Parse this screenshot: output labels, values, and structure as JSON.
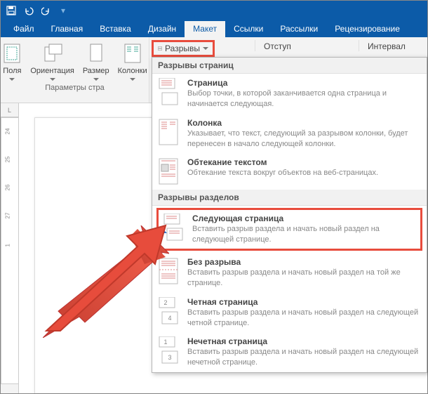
{
  "tabs": {
    "file": "Файл",
    "home": "Главная",
    "insert": "Вставка",
    "design": "Дизайн",
    "layout": "Макет",
    "references": "Ссылки",
    "mailings": "Рассылки",
    "review": "Рецензирование"
  },
  "ribbon": {
    "fields": "Поля",
    "orientation": "Ориентация",
    "size": "Размер",
    "columns": "Колонки",
    "page_setup_label": "Параметры стра",
    "breaks": "Разрывы",
    "indent": "Отступ",
    "spacing": "Интервал"
  },
  "dropdown": {
    "section1": "Разрывы страниц",
    "section2": "Разрывы разделов",
    "page": {
      "title": "Страница",
      "desc": "Выбор точки, в которой заканчивается одна страница и начинается следующая."
    },
    "column": {
      "title": "Колонка",
      "desc": "Указывает, что текст, следующий за разрывом колонки, будет перенесен в начало следующей колонки."
    },
    "textwrap": {
      "title": "Обтекание текстом",
      "desc": "Обтекание текста вокруг объектов на веб-страницах."
    },
    "nextpage": {
      "title": "Следующая страница",
      "desc": "Вставить разрыв раздела и начать новый раздел на следующей странице."
    },
    "continuous": {
      "title": "Без разрыва",
      "desc": "Вставить разрыв раздела и начать новый раздел на той же странице."
    },
    "evenpage": {
      "title": "Четная страница",
      "desc": "Вставить разрыв раздела и начать новый раздел на следующей четной странице."
    },
    "oddpage": {
      "title": "Нечетная страница",
      "desc": "Вставить разрыв раздела и начать новый раздел на следующей нечетной странице."
    }
  },
  "ruler_label": "L"
}
